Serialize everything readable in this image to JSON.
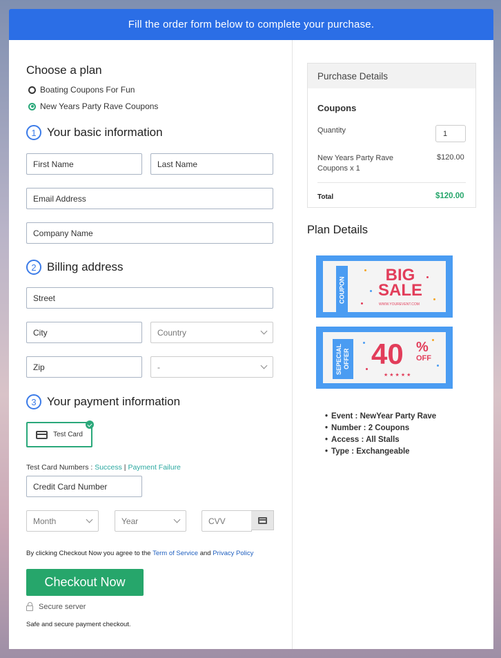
{
  "banner": {
    "text": "Fill the order form below to complete your purchase."
  },
  "plan": {
    "title": "Choose a plan",
    "options": [
      {
        "label": "Boating Coupons For Fun",
        "selected": false
      },
      {
        "label": "New Years Party Rave Coupons",
        "selected": true
      }
    ]
  },
  "basic_info": {
    "step_number": "1",
    "title": "Your basic information",
    "first_name_placeholder": "First Name",
    "last_name_placeholder": "Last Name",
    "email_placeholder": "Email Address",
    "company_placeholder": "Company Name"
  },
  "billing": {
    "step_number": "2",
    "title": "Billing address",
    "street_placeholder": "Street",
    "city_placeholder": "City",
    "country_selected": "Country",
    "zip_placeholder": "Zip",
    "state_selected": "-"
  },
  "payment": {
    "step_number": "3",
    "title": "Your payment information",
    "test_card_label": "Test Card",
    "test_numbers_label": "Test Card Numbers : ",
    "success_link": "Success",
    "separator": " | ",
    "failure_link": "Payment Failure",
    "card_number_placeholder": "Credit Card Number",
    "month_selected": "Month",
    "year_selected": "Year",
    "cvv_placeholder": "CVV"
  },
  "checkout": {
    "agree_prefix": "By clicking Checkout Now you agree to the ",
    "terms_link": "Term of Service",
    "and": " and ",
    "privacy_link": "Privacy Policy",
    "button_label": "Checkout Now",
    "secure_label": "Secure server",
    "safe_text": "Safe and secure payment checkout."
  },
  "purchase": {
    "header": "Purchase Details",
    "section": "Coupons",
    "quantity_label": "Quantity",
    "quantity_value": "1",
    "item_line1": "New Years Party Rave",
    "item_line2": "Coupons x 1",
    "item_price": "$120.00",
    "total_label": "Total",
    "total_value": "$120.00",
    "total_color": "#26a66b"
  },
  "plan_details": {
    "title": "Plan Details",
    "coupon1": {
      "ribbon": "COUPON",
      "line1": "BIG",
      "line2": "SALE",
      "url": "WWW.YOUREVENT.COM"
    },
    "coupon2": {
      "ribbon": "SEPECIAL OFFER",
      "percent": "40",
      "percent_sign": "%",
      "off": "OFF",
      "stars": "★★★★★"
    },
    "bullets": [
      "Event : NewYear Party Rave",
      "Number : 2 Coupons",
      "Access : All Stalls",
      "Type : Exchangeable"
    ]
  },
  "colors": {
    "banner": "#2b6ee6",
    "accent_green": "#26a66b",
    "step_blue": "#3b7be8",
    "coupon_blue": "#4a9cf2",
    "coupon_red": "#e23d5a"
  }
}
